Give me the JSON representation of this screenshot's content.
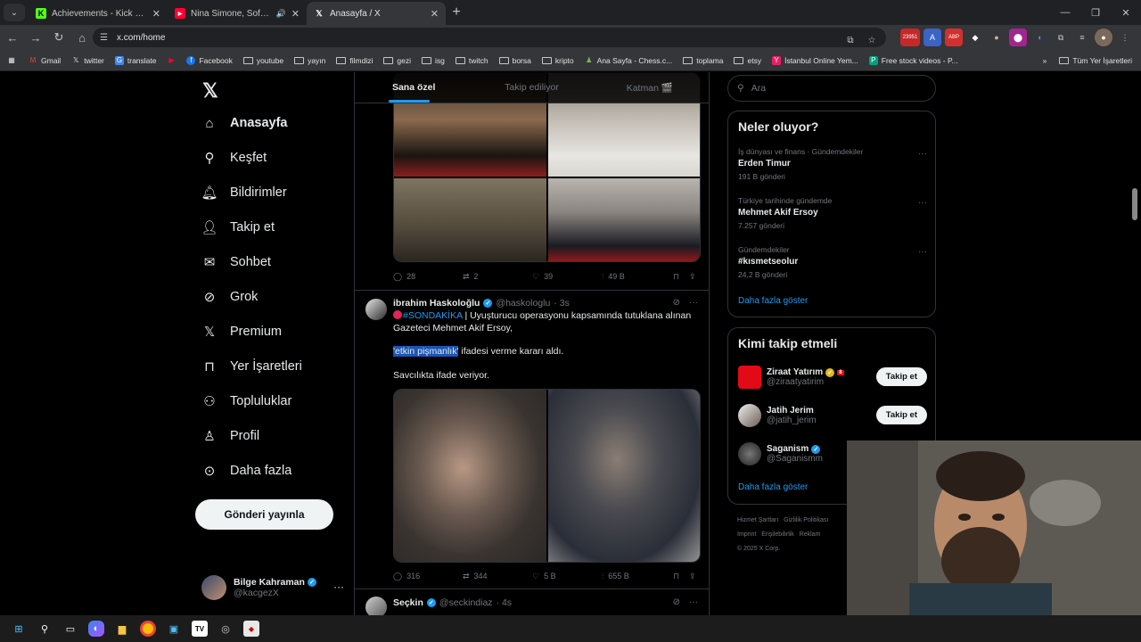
{
  "browser": {
    "tabs": [
      {
        "title": "Achievements - Kick Dashboard",
        "favicon": "kick-icon",
        "active": false
      },
      {
        "title": "Nina Simone, Sofi Tukker -",
        "favicon": "youtube-icon",
        "active": false
      },
      {
        "title": "Anasayfa / X",
        "favicon": "x-icon",
        "active": true
      }
    ],
    "url": "x.com/home",
    "badge_count": "23951",
    "bookmarks": [
      {
        "label": "Gmail",
        "icon": "gmail-icon"
      },
      {
        "label": "twitter",
        "icon": "x-icon"
      },
      {
        "label": "translate",
        "icon": "translate-icon"
      },
      {
        "label": "Facebook",
        "icon": "facebook-icon"
      },
      {
        "label": "youtube",
        "icon": "folder-icon"
      },
      {
        "label": "yayın",
        "icon": "folder-icon"
      },
      {
        "label": "filmdizi",
        "icon": "folder-icon"
      },
      {
        "label": "gezi",
        "icon": "folder-icon"
      },
      {
        "label": "isg",
        "icon": "folder-icon"
      },
      {
        "label": "twitch",
        "icon": "folder-icon"
      },
      {
        "label": "borsa",
        "icon": "folder-icon"
      },
      {
        "label": "kripto",
        "icon": "folder-icon"
      },
      {
        "label": "Ana Sayfa - Chess.c...",
        "icon": "chess-icon"
      },
      {
        "label": "toplama",
        "icon": "folder-icon"
      },
      {
        "label": "etsy",
        "icon": "folder-icon"
      },
      {
        "label": "İstanbul Online Yem...",
        "icon": "yemek-icon"
      },
      {
        "label": "Free stock videos - P...",
        "icon": "pexels-icon"
      }
    ],
    "all_bookmarks": "Tüm Yer İşaretleri"
  },
  "sidebar": {
    "items": [
      {
        "label": "Anasayfa",
        "icon": "home-icon"
      },
      {
        "label": "Keşfet",
        "icon": "search-icon"
      },
      {
        "label": "Bildirimler",
        "icon": "bell-icon"
      },
      {
        "label": "Takip et",
        "icon": "follow-icon"
      },
      {
        "label": "Sohbet",
        "icon": "mail-icon"
      },
      {
        "label": "Grok",
        "icon": "grok-icon"
      },
      {
        "label": "Premium",
        "icon": "x-icon"
      },
      {
        "label": "Yer İşaretleri",
        "icon": "bookmark-icon"
      },
      {
        "label": "Topluluklar",
        "icon": "communities-icon"
      },
      {
        "label": "Profil",
        "icon": "person-icon"
      },
      {
        "label": "Daha fazla",
        "icon": "more-circle-icon"
      }
    ],
    "post_button": "Gönderi yayınla",
    "account": {
      "name": "Bilge Kahraman",
      "handle": "@kacgezX"
    }
  },
  "timeline": {
    "tabs": [
      "Sana özel",
      "Takip ediliyor",
      "Katman 🎬"
    ],
    "tweet1": {
      "replies": "28",
      "retweets": "2",
      "likes": "39",
      "views": "49 B"
    },
    "tweet2": {
      "name": "ibrahim Haskoloğlu",
      "handle": "@haskologlu",
      "time": "· 3s",
      "hashtag": "#SONDAKİKA",
      "line1": " | Uyuşturucu operasyonu kapsamında tutuklana alınan Gazeteci Mehmet Akif Ersoy,",
      "highlight": "'etkin pişmanlık'",
      "line2": " ifadesi verme kararı aldı.",
      "line3": "Savcılıkta ifade veriyor.",
      "replies": "316",
      "retweets": "344",
      "likes": "5 B",
      "views": "655 B"
    },
    "tweet3": {
      "name": "Seçkin",
      "handle": "@seckindiaz",
      "time": "· 4s"
    }
  },
  "right": {
    "search_placeholder": "Ara",
    "trends_title": "Neler oluyor?",
    "trends": [
      {
        "context": "İş dünyası ve finans · Gündemdekiler",
        "topic": "Erden Timur",
        "count": "191 B gönderi"
      },
      {
        "context": "Türkiye tarihinde gündemde",
        "topic": "Mehmet Akif Ersoy",
        "count": "7.257 gönderi"
      },
      {
        "context": "Gündemdekiler",
        "topic": "#kısmetseolur",
        "count": "24,2 B gönderi"
      }
    ],
    "show_more": "Daha fazla göster",
    "who_title": "Kimi takip etmeli",
    "who": [
      {
        "name": "Ziraat Yatırım",
        "handle": "@ziraatyatirim",
        "follow": "Takip et"
      },
      {
        "name": "Jatih Jerim",
        "handle": "@jatih_jerim",
        "follow": "Takip et"
      },
      {
        "name": "Saganism",
        "handle": "@Saganismm",
        "follow": ""
      }
    ],
    "footer": [
      "Hizmet Şartları",
      "Gizlilik Politikası",
      "Imprint",
      "Erişilebilirlik",
      "Reklam",
      "© 2025 X Corp."
    ]
  }
}
